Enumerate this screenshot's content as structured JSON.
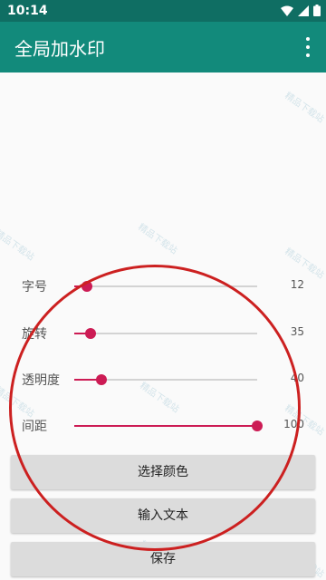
{
  "status": {
    "time": "10:14"
  },
  "appbar": {
    "title": "全局加水印"
  },
  "watermark": {
    "text": "精品下载站"
  },
  "sliders": [
    {
      "label": "字号",
      "value": "12",
      "fraction": 0.07
    },
    {
      "label": "旋转",
      "value": "35",
      "fraction": 0.09
    },
    {
      "label": "透明度",
      "value": "40",
      "fraction": 0.15
    },
    {
      "label": "间距",
      "value": "100",
      "fraction": 1.0
    }
  ],
  "buttons": {
    "color": "选择颜色",
    "text": "输入文本",
    "save": "保存"
  },
  "colors": {
    "statusbar": "#0f6e63",
    "appbar": "#128a7b",
    "accent": "#cc1b54",
    "annotation": "#cc2020"
  }
}
